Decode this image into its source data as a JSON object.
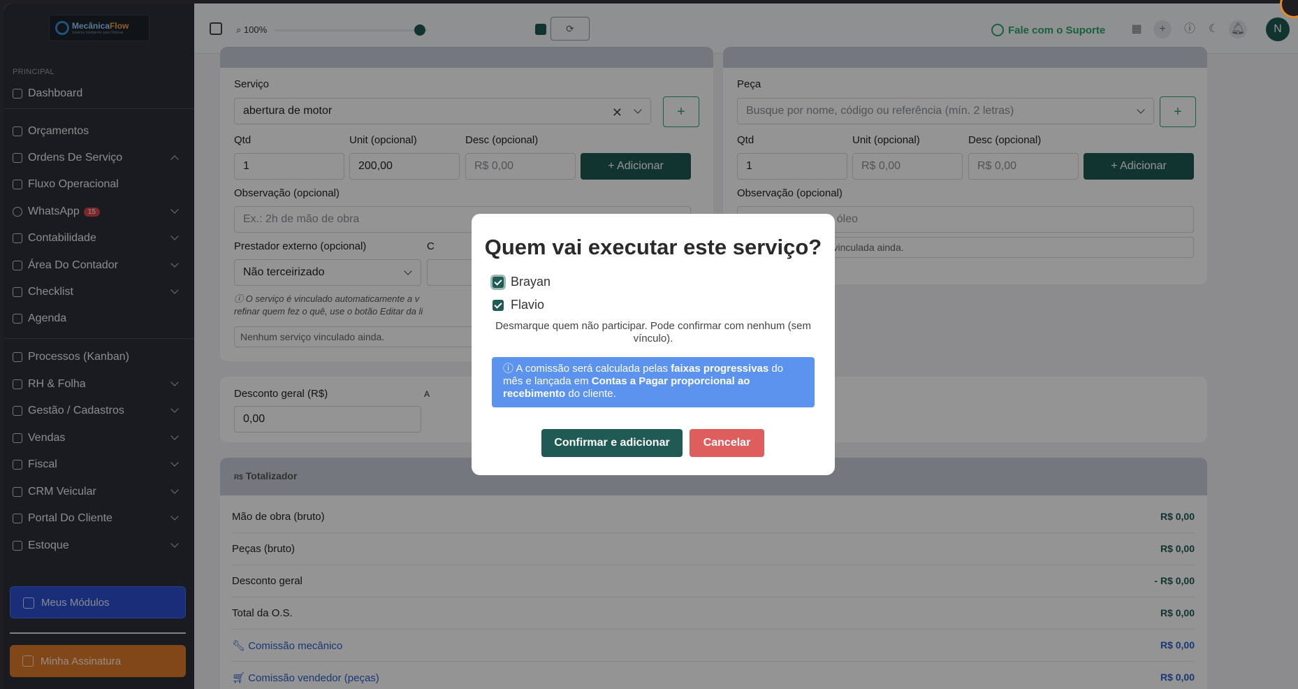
{
  "topbar": {
    "zoom_label": "100%",
    "support_label": "Fale com o Suporte",
    "avatar_initial": "N",
    "refresh_icon": "refresh-icon"
  },
  "sidebar": {
    "logo_text_a": "Mecânica",
    "logo_text_b": "Flow",
    "logo_tagline": "Sistema Inteligente para Oficinas",
    "section_label": "PRINCIPAL",
    "items": [
      {
        "label": "Dashboard"
      },
      {
        "label": "Orçamentos"
      },
      {
        "label": "Ordens De Serviço"
      },
      {
        "label": "Fluxo Operacional"
      },
      {
        "label": "WhatsApp",
        "badge": "15"
      },
      {
        "label": "Contabilidade"
      },
      {
        "label": "Área Do Contador"
      },
      {
        "label": "Checklist"
      },
      {
        "label": "Agenda"
      },
      {
        "label": "Processos (Kanban)"
      },
      {
        "label": "RH & Folha"
      },
      {
        "label": "Gestão / Cadastros"
      },
      {
        "label": "Vendas"
      },
      {
        "label": "Fiscal"
      },
      {
        "label": "CRM Veicular"
      },
      {
        "label": "Portal Do Cliente"
      },
      {
        "label": "Estoque"
      }
    ],
    "modules_button": "Meus Módulos",
    "subscription_button": "Minha Assinatura"
  },
  "service": {
    "label": "Serviço",
    "value": "abertura de motor",
    "qtd_label": "Qtd",
    "qtd_value": "1",
    "unit_label": "Unit (opcional)",
    "unit_value": "200,00",
    "desc_label": "Desc (opcional)",
    "desc_placeholder": "R$ 0,00",
    "add_button": "+ Adicionar",
    "obs_label": "Observação (opcional)",
    "obs_placeholder": "Ex.: 2h de mão de obra",
    "prestador_label": "Prestador externo (opcional)",
    "prestador_value": "Não terceirizado",
    "col2_label_partial": "C",
    "note": "O serviço é vinculado automaticamente a v",
    "note2": "refinar quem fez o quê, use o botão Editar da li",
    "empty": "Nenhum serviço vinculado ainda."
  },
  "part": {
    "label": "Peça",
    "placeholder": "Busque por nome, código ou referência (mín. 2 letras)",
    "qtd_label": "Qtd",
    "qtd_value": "1",
    "unit_label": "Unit (opcional)",
    "unit_placeholder": "R$ 0,00",
    "desc_label": "Desc (opcional)",
    "desc_placeholder": "R$ 0,00",
    "add_button": "+ Adicionar",
    "obs_label": "Observação (opcional)",
    "obs_placeholder_partial": "e óleo",
    "empty_partial": "eça vinculada ainda."
  },
  "discount": {
    "label": "Desconto geral (R$)",
    "value": "0,00",
    "col2_partial": "A"
  },
  "totals": {
    "title": "Totalizador",
    "rows": [
      {
        "label": "Mão de obra (bruto)",
        "value": "R$ 0,00"
      },
      {
        "label": "Peças (bruto)",
        "value": "R$ 0,00"
      },
      {
        "label": "Desconto geral",
        "value": "- R$ 0,00"
      },
      {
        "label": "Total da O.S.",
        "value": "R$ 0,00"
      },
      {
        "label": "Comissão mecânico",
        "value": "R$ 0,00"
      },
      {
        "label": "Comissão vendedor (peças)",
        "value": "R$ 0,00"
      }
    ]
  },
  "modal": {
    "title": "Quem vai executar este serviço?",
    "people": [
      {
        "name": "Brayan",
        "checked": true
      },
      {
        "name": "Flavio",
        "checked": true
      }
    ],
    "help": "Desmarque quem não participar. Pode confirmar com nenhum (sem vínculo).",
    "info_a": "A comissão será calculada pelas ",
    "info_b": "faixas progressivas",
    "info_c": " do mês e lançada em ",
    "info_d": "Contas a Pagar proporcional ao recebimento",
    "info_e": " do cliente.",
    "confirm": "Confirmar e adicionar",
    "cancel": "Cancelar"
  },
  "colors": {
    "primary": "#1f5a55",
    "danger": "#de5d5d",
    "info": "#5b93ef",
    "success": "#2ca66a"
  }
}
